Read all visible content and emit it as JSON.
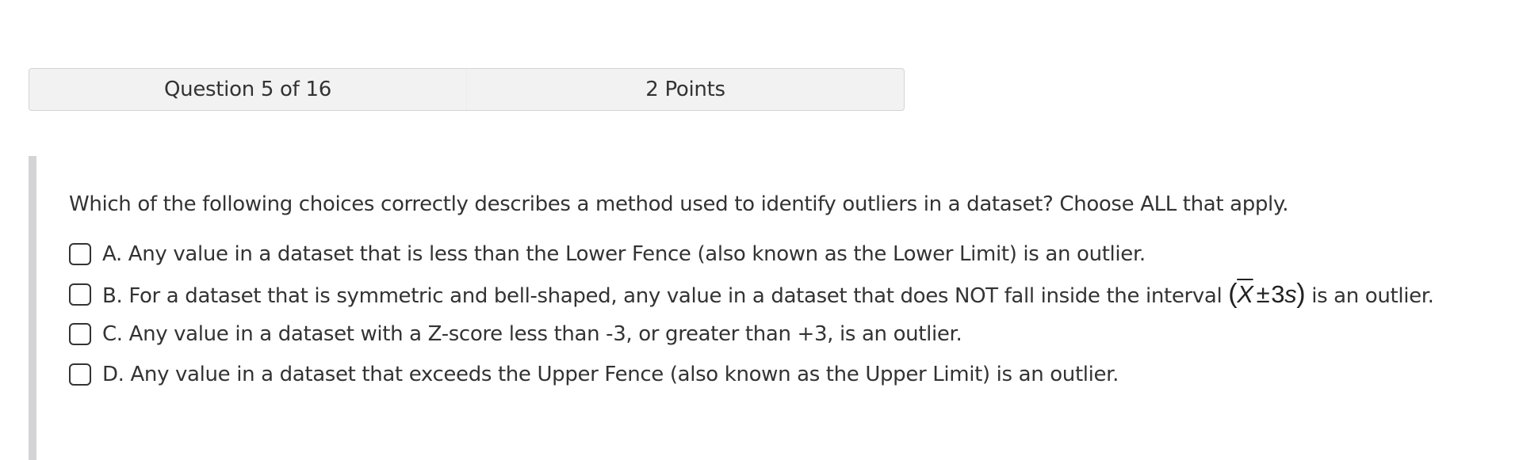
{
  "header": {
    "question_position": "Question 5 of 16",
    "points": "2 Points"
  },
  "question": {
    "prompt": "Which of the following choices correctly describes a method used to identify outliers in a dataset? Choose ALL that apply.",
    "input_type": "checkbox",
    "options": [
      {
        "label": "A. Any value in a dataset that is less than the Lower Fence (also known as the Lower Limit) is an outlier.",
        "checked": false
      },
      {
        "label_before_math": "B. For a dataset that is symmetric and bell-shaped, any value in a dataset that does NOT fall inside the interval ",
        "math": {
          "open": "(",
          "xbar": "X",
          "pm": "±",
          "coef": "3",
          "s": "s",
          "close": ")"
        },
        "label_after_math": " is an outlier.",
        "checked": false
      },
      {
        "label": "C. Any value in a dataset with a Z-score less than -3, or greater than +3, is an outlier.",
        "checked": false
      },
      {
        "label": "D. Any value in a dataset that exceeds the Upper Fence (also known as the Upper Limit) is an outlier.",
        "checked": false
      }
    ]
  }
}
